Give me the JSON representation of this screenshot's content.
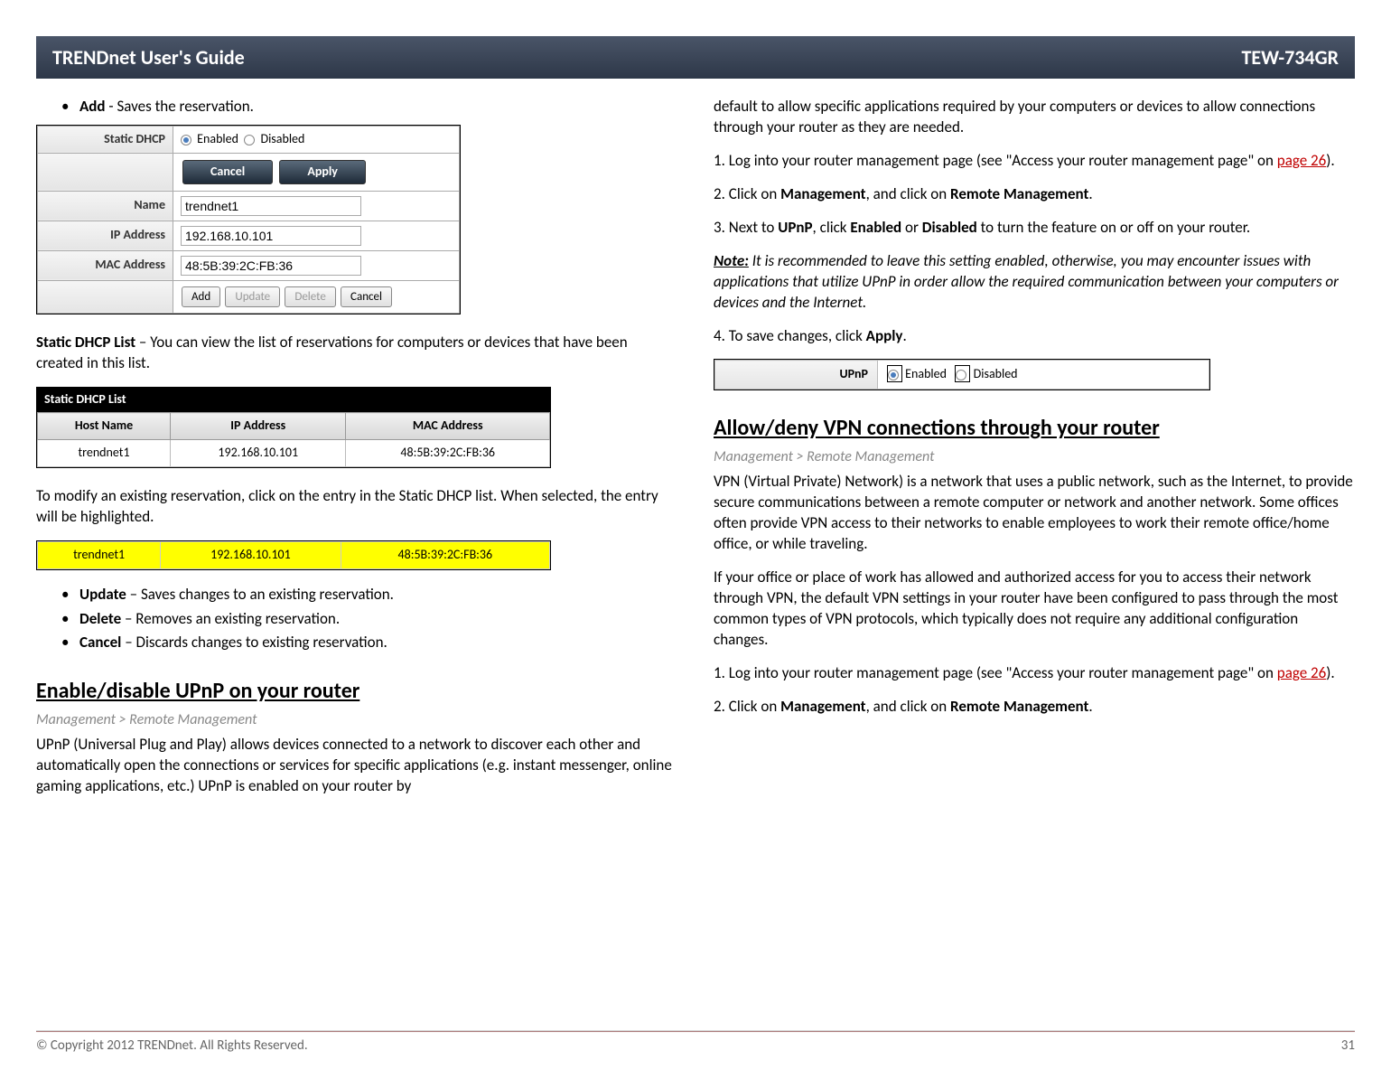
{
  "header": {
    "title": "TRENDnet User's Guide",
    "model": "TEW-734GR"
  },
  "left": {
    "add_b": "Add",
    "add_rest": " - Saves the reservation.",
    "form": {
      "rows": {
        "static_dhcp_lbl": "Static DHCP",
        "enabled": "Enabled",
        "disabled": "Disabled",
        "cancel_btn": "Cancel",
        "apply_btn": "Apply",
        "name_lbl": "Name",
        "name_val": "trendnet1",
        "ip_lbl": "IP Address",
        "ip_val": "192.168.10.101",
        "mac_lbl": "MAC Address",
        "mac_val": "48:5B:39:2C:FB:36",
        "add_btn": "Add",
        "update_btn": "Update",
        "delete_btn": "Delete",
        "cancel2_btn": "Cancel"
      }
    },
    "list_intro_b": "Static DHCP List",
    "list_intro_rest": " – You can view the list of reservations for computers or devices that have been created in this list.",
    "list": {
      "title": "Static DHCP List",
      "h1": "Host Name",
      "h2": "IP Address",
      "h3": "MAC Address",
      "r1c1": "trendnet1",
      "r1c2": "192.168.10.101",
      "r1c3": "48:5B:39:2C:FB:36"
    },
    "modify_text": "To modify an existing reservation, click on the entry in the Static DHCP list. When selected, the entry will be highlighted.",
    "hl": {
      "c1": "trendnet1",
      "c2": "192.168.10.101",
      "c3": "48:5B:39:2C:FB:36"
    },
    "upd_b": "Update",
    "upd_rest": " – Saves changes to an existing reservation.",
    "del_b": "Delete",
    "del_rest": " – Removes an existing reservation.",
    "can_b": "Cancel",
    "can_rest": " – Discards changes to existing reservation.",
    "sec_upnp": "Enable/disable UPnP on your router",
    "crumb": "Management > Remote Management",
    "upnp_para": "UPnP (Universal Plug and Play) allows devices connected to a network to discover each other and automatically open the connections or services for specific applications (e.g. instant messenger, online gaming applications, etc.) UPnP is enabled on your router by"
  },
  "right": {
    "cont": "default to allow specific applications required by your computers or devices to allow connections through your router as they are needed.",
    "step1_a": "1. Log into your router management page (see \"Access your router management page\" on ",
    "step1_link": "page 26",
    "step1_b": ").",
    "step2_a": "2. Click on ",
    "step2_b": "Management",
    "step2_c": ", and click on ",
    "step2_d": "Remote Management",
    "step2_e": ".",
    "step3_a": "3. Next to ",
    "step3_b": "UPnP",
    "step3_c": ", click ",
    "step3_d": "Enabled",
    "step3_e": " or ",
    "step3_f": "Disabled",
    "step3_g": " to turn the feature on or off on your router.",
    "note_b": "Note:",
    "note_rest": " It is recommended to leave this setting enabled, otherwise, you may encounter issues with applications that utilize UPnP in order allow the required communication between your computers or devices and the Internet.",
    "step4_a": "4. To save changes, click ",
    "step4_b": "Apply",
    "step4_c": ".",
    "upnp_lbl": "UPnP",
    "upnp_en": "Enabled",
    "upnp_dis": "Disabled",
    "sec_vpn": "Allow/deny VPN connections through your router",
    "crumb": "Management > Remote Management",
    "vpn_p1": "VPN (Virtual Private) Network) is a network that uses a public network, such as the Internet, to provide secure communications between a remote computer or network and another network. Some offices often provide VPN access to their networks to enable employees to work their remote office/home office, or while traveling.",
    "vpn_p2": "If your office or place of work has allowed and authorized access for you to access their network through VPN, the default VPN settings in your router have been configured to pass through the most common types of VPN protocols, which typically does not require any additional configuration changes.",
    "vpn_s1_a": "1. Log into your router management page (see \"Access your router management page\" on ",
    "vpn_s1_link": "page 26",
    "vpn_s1_b": ").",
    "vpn_s2_a": "2. Click on ",
    "vpn_s2_b": "Management",
    "vpn_s2_c": ", and click on ",
    "vpn_s2_d": "Remote Management",
    "vpn_s2_e": "."
  },
  "footer": {
    "copy": "© Copyright 2012 TRENDnet. All Rights Reserved.",
    "page": "31"
  }
}
